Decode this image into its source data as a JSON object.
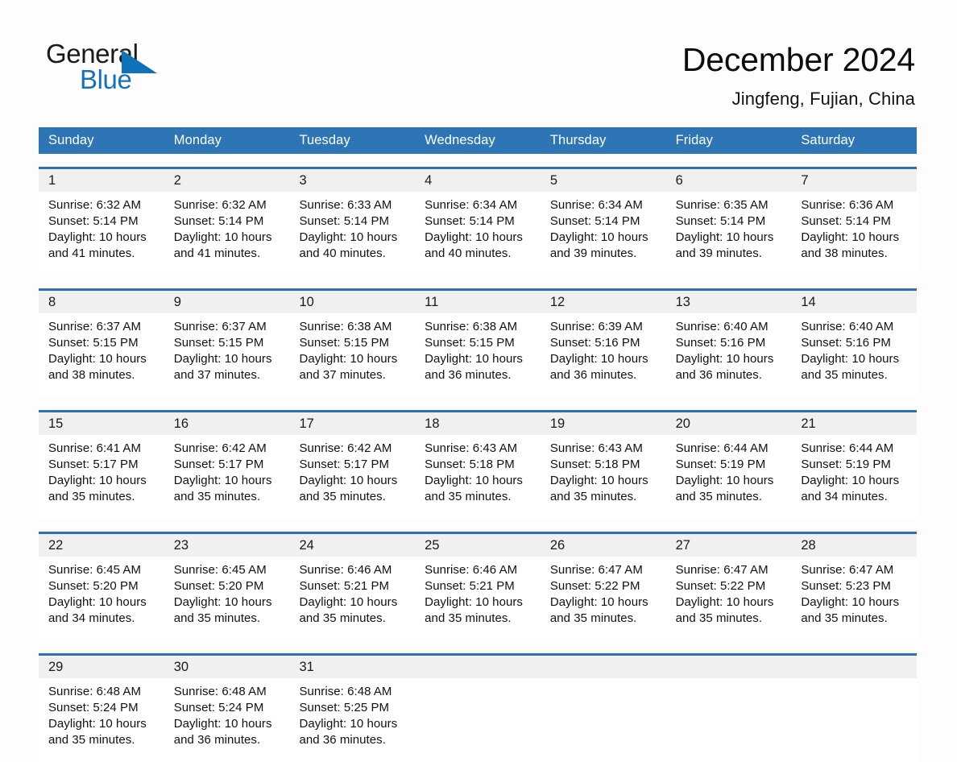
{
  "brand": {
    "name_part1": "General",
    "name_part2": "Blue",
    "accent_color": "#1272bb",
    "triangle_icon": "logo-triangle-icon"
  },
  "header": {
    "title": "December 2024",
    "location": "Jingfeng, Fujian, China"
  },
  "colors": {
    "header_blue": "#2e75b6",
    "week_rule_blue": "#2e70b4",
    "date_band_gray": "#f0f0f0",
    "page_background": "#fdfdfd"
  },
  "weekday_headers": [
    "Sunday",
    "Monday",
    "Tuesday",
    "Wednesday",
    "Thursday",
    "Friday",
    "Saturday"
  ],
  "weeks": [
    {
      "days": [
        {
          "date": "1",
          "sunrise": "Sunrise: 6:32 AM",
          "sunset": "Sunset: 5:14 PM",
          "daylight_line1": "Daylight: 10 hours",
          "daylight_line2": "and 41 minutes."
        },
        {
          "date": "2",
          "sunrise": "Sunrise: 6:32 AM",
          "sunset": "Sunset: 5:14 PM",
          "daylight_line1": "Daylight: 10 hours",
          "daylight_line2": "and 41 minutes."
        },
        {
          "date": "3",
          "sunrise": "Sunrise: 6:33 AM",
          "sunset": "Sunset: 5:14 PM",
          "daylight_line1": "Daylight: 10 hours",
          "daylight_line2": "and 40 minutes."
        },
        {
          "date": "4",
          "sunrise": "Sunrise: 6:34 AM",
          "sunset": "Sunset: 5:14 PM",
          "daylight_line1": "Daylight: 10 hours",
          "daylight_line2": "and 40 minutes."
        },
        {
          "date": "5",
          "sunrise": "Sunrise: 6:34 AM",
          "sunset": "Sunset: 5:14 PM",
          "daylight_line1": "Daylight: 10 hours",
          "daylight_line2": "and 39 minutes."
        },
        {
          "date": "6",
          "sunrise": "Sunrise: 6:35 AM",
          "sunset": "Sunset: 5:14 PM",
          "daylight_line1": "Daylight: 10 hours",
          "daylight_line2": "and 39 minutes."
        },
        {
          "date": "7",
          "sunrise": "Sunrise: 6:36 AM",
          "sunset": "Sunset: 5:14 PM",
          "daylight_line1": "Daylight: 10 hours",
          "daylight_line2": "and 38 minutes."
        }
      ]
    },
    {
      "days": [
        {
          "date": "8",
          "sunrise": "Sunrise: 6:37 AM",
          "sunset": "Sunset: 5:15 PM",
          "daylight_line1": "Daylight: 10 hours",
          "daylight_line2": "and 38 minutes."
        },
        {
          "date": "9",
          "sunrise": "Sunrise: 6:37 AM",
          "sunset": "Sunset: 5:15 PM",
          "daylight_line1": "Daylight: 10 hours",
          "daylight_line2": "and 37 minutes."
        },
        {
          "date": "10",
          "sunrise": "Sunrise: 6:38 AM",
          "sunset": "Sunset: 5:15 PM",
          "daylight_line1": "Daylight: 10 hours",
          "daylight_line2": "and 37 minutes."
        },
        {
          "date": "11",
          "sunrise": "Sunrise: 6:38 AM",
          "sunset": "Sunset: 5:15 PM",
          "daylight_line1": "Daylight: 10 hours",
          "daylight_line2": "and 36 minutes."
        },
        {
          "date": "12",
          "sunrise": "Sunrise: 6:39 AM",
          "sunset": "Sunset: 5:16 PM",
          "daylight_line1": "Daylight: 10 hours",
          "daylight_line2": "and 36 minutes."
        },
        {
          "date": "13",
          "sunrise": "Sunrise: 6:40 AM",
          "sunset": "Sunset: 5:16 PM",
          "daylight_line1": "Daylight: 10 hours",
          "daylight_line2": "and 36 minutes."
        },
        {
          "date": "14",
          "sunrise": "Sunrise: 6:40 AM",
          "sunset": "Sunset: 5:16 PM",
          "daylight_line1": "Daylight: 10 hours",
          "daylight_line2": "and 35 minutes."
        }
      ]
    },
    {
      "days": [
        {
          "date": "15",
          "sunrise": "Sunrise: 6:41 AM",
          "sunset": "Sunset: 5:17 PM",
          "daylight_line1": "Daylight: 10 hours",
          "daylight_line2": "and 35 minutes."
        },
        {
          "date": "16",
          "sunrise": "Sunrise: 6:42 AM",
          "sunset": "Sunset: 5:17 PM",
          "daylight_line1": "Daylight: 10 hours",
          "daylight_line2": "and 35 minutes."
        },
        {
          "date": "17",
          "sunrise": "Sunrise: 6:42 AM",
          "sunset": "Sunset: 5:17 PM",
          "daylight_line1": "Daylight: 10 hours",
          "daylight_line2": "and 35 minutes."
        },
        {
          "date": "18",
          "sunrise": "Sunrise: 6:43 AM",
          "sunset": "Sunset: 5:18 PM",
          "daylight_line1": "Daylight: 10 hours",
          "daylight_line2": "and 35 minutes."
        },
        {
          "date": "19",
          "sunrise": "Sunrise: 6:43 AM",
          "sunset": "Sunset: 5:18 PM",
          "daylight_line1": "Daylight: 10 hours",
          "daylight_line2": "and 35 minutes."
        },
        {
          "date": "20",
          "sunrise": "Sunrise: 6:44 AM",
          "sunset": "Sunset: 5:19 PM",
          "daylight_line1": "Daylight: 10 hours",
          "daylight_line2": "and 35 minutes."
        },
        {
          "date": "21",
          "sunrise": "Sunrise: 6:44 AM",
          "sunset": "Sunset: 5:19 PM",
          "daylight_line1": "Daylight: 10 hours",
          "daylight_line2": "and 34 minutes."
        }
      ]
    },
    {
      "days": [
        {
          "date": "22",
          "sunrise": "Sunrise: 6:45 AM",
          "sunset": "Sunset: 5:20 PM",
          "daylight_line1": "Daylight: 10 hours",
          "daylight_line2": "and 34 minutes."
        },
        {
          "date": "23",
          "sunrise": "Sunrise: 6:45 AM",
          "sunset": "Sunset: 5:20 PM",
          "daylight_line1": "Daylight: 10 hours",
          "daylight_line2": "and 35 minutes."
        },
        {
          "date": "24",
          "sunrise": "Sunrise: 6:46 AM",
          "sunset": "Sunset: 5:21 PM",
          "daylight_line1": "Daylight: 10 hours",
          "daylight_line2": "and 35 minutes."
        },
        {
          "date": "25",
          "sunrise": "Sunrise: 6:46 AM",
          "sunset": "Sunset: 5:21 PM",
          "daylight_line1": "Daylight: 10 hours",
          "daylight_line2": "and 35 minutes."
        },
        {
          "date": "26",
          "sunrise": "Sunrise: 6:47 AM",
          "sunset": "Sunset: 5:22 PM",
          "daylight_line1": "Daylight: 10 hours",
          "daylight_line2": "and 35 minutes."
        },
        {
          "date": "27",
          "sunrise": "Sunrise: 6:47 AM",
          "sunset": "Sunset: 5:22 PM",
          "daylight_line1": "Daylight: 10 hours",
          "daylight_line2": "and 35 minutes."
        },
        {
          "date": "28",
          "sunrise": "Sunrise: 6:47 AM",
          "sunset": "Sunset: 5:23 PM",
          "daylight_line1": "Daylight: 10 hours",
          "daylight_line2": "and 35 minutes."
        }
      ]
    },
    {
      "days": [
        {
          "date": "29",
          "sunrise": "Sunrise: 6:48 AM",
          "sunset": "Sunset: 5:24 PM",
          "daylight_line1": "Daylight: 10 hours",
          "daylight_line2": "and 35 minutes."
        },
        {
          "date": "30",
          "sunrise": "Sunrise: 6:48 AM",
          "sunset": "Sunset: 5:24 PM",
          "daylight_line1": "Daylight: 10 hours",
          "daylight_line2": "and 36 minutes."
        },
        {
          "date": "31",
          "sunrise": "Sunrise: 6:48 AM",
          "sunset": "Sunset: 5:25 PM",
          "daylight_line1": "Daylight: 10 hours",
          "daylight_line2": "and 36 minutes."
        },
        {
          "date": "",
          "sunrise": "",
          "sunset": "",
          "daylight_line1": "",
          "daylight_line2": ""
        },
        {
          "date": "",
          "sunrise": "",
          "sunset": "",
          "daylight_line1": "",
          "daylight_line2": ""
        },
        {
          "date": "",
          "sunrise": "",
          "sunset": "",
          "daylight_line1": "",
          "daylight_line2": ""
        },
        {
          "date": "",
          "sunrise": "",
          "sunset": "",
          "daylight_line1": "",
          "daylight_line2": ""
        }
      ]
    }
  ]
}
